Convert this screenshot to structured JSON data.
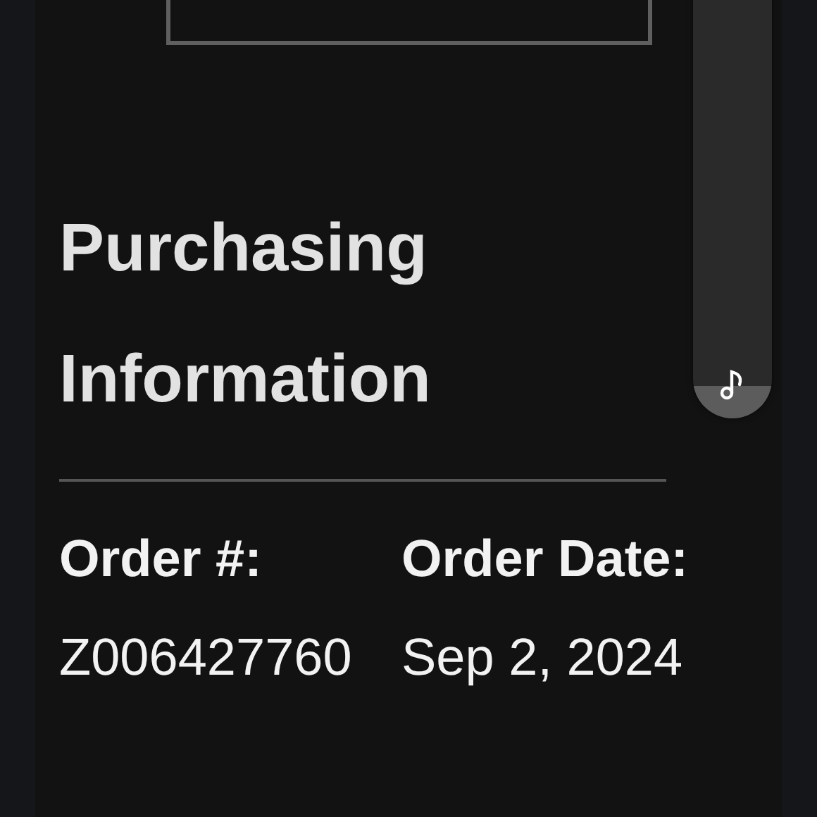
{
  "section": {
    "title": "Purchasing Information"
  },
  "order": [
    {
      "label": "Order #:",
      "value": "Z006427760"
    },
    {
      "label": "Order Date:",
      "value": "Sep 2, 2024"
    }
  ],
  "volume_slider": {
    "level": 0.07
  }
}
